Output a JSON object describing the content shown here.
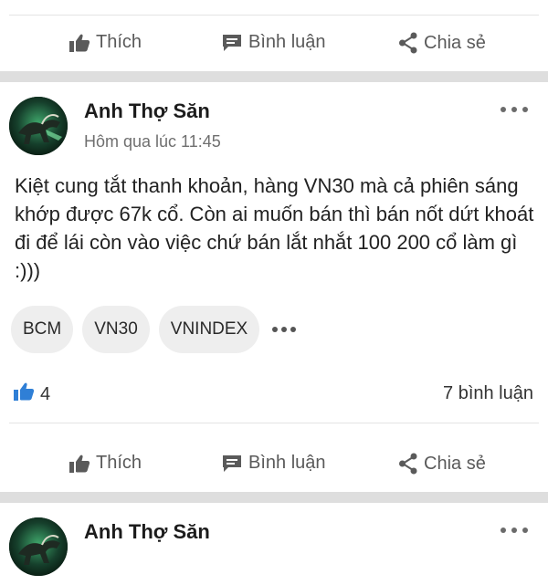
{
  "actions": {
    "like_label": "Thích",
    "comment_label": "Bình luận",
    "share_label": "Chia sẻ"
  },
  "post": {
    "author": "Anh Thợ Săn",
    "timestamp": "Hôm qua lúc 11:45",
    "content": "Kiệt cung tắt thanh khoản, hàng VN30 mà cả phiên sáng khớp được 67k cổ. Còn ai muốn bán thì bán nốt dứt khoát đi để lái còn vào việc chứ bán lắt nhắt 100 200 cổ làm gì :)))",
    "tags": [
      "BCM",
      "VN30",
      "VNINDEX"
    ],
    "like_count": "4",
    "comment_count": "7 bình luận"
  },
  "next_post": {
    "author": "Anh Thợ Săn"
  },
  "colors": {
    "accent_blue": "#2f7fd6",
    "action_gray": "#5a5a5a",
    "separator": "#dedede"
  },
  "icons": {
    "like": "thumbs-up-icon",
    "comment": "chat-bubble-icon",
    "share": "share-icon",
    "more": "more-dots-icon"
  }
}
